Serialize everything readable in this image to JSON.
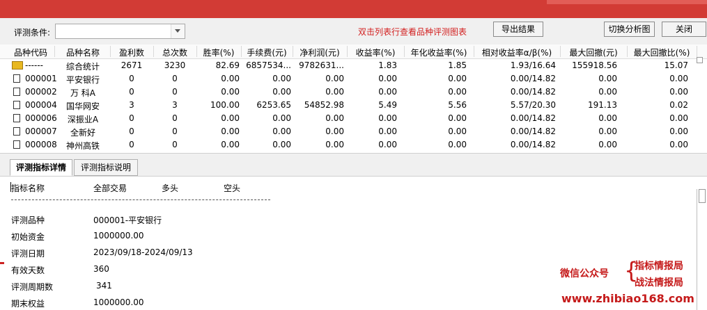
{
  "toolbar": {
    "condition_label": "评测条件:",
    "condition_value": "",
    "hint": "双击列表行查看品种评测图表",
    "export_label": "导出结果",
    "switch_label": "切换分析图",
    "close_label": "关闭"
  },
  "table": {
    "columns": [
      "品种代码",
      "品种名称",
      "盈利数",
      "总次数",
      "胜率(%)",
      "手续费(元)",
      "净利润(元)",
      "收益率(%)",
      "年化收益率(%)",
      "相对收益率α/β(%)",
      "最大回撤(元)",
      "最大回撤比(%)"
    ],
    "rows": [
      {
        "icon": "folder",
        "code": "------",
        "name": "综合统计",
        "win": "2671",
        "total": "3230",
        "rate": "82.69",
        "fee": "6857534...",
        "profit": "9782631...",
        "ret": "1.83",
        "annual": "1.85",
        "rel": "1.93/16.64",
        "dd": "155918.56",
        "ddr": "15.07"
      },
      {
        "icon": "doc",
        "code": "000001",
        "name": "平安银行",
        "win": "0",
        "total": "0",
        "rate": "0.00",
        "fee": "0.00",
        "profit": "0.00",
        "ret": "0.00",
        "annual": "0.00",
        "rel": "0.00/14.82",
        "dd": "0.00",
        "ddr": "0.00"
      },
      {
        "icon": "doc",
        "code": "000002",
        "name": "万 科A",
        "win": "0",
        "total": "0",
        "rate": "0.00",
        "fee": "0.00",
        "profit": "0.00",
        "ret": "0.00",
        "annual": "0.00",
        "rel": "0.00/14.82",
        "dd": "0.00",
        "ddr": "0.00"
      },
      {
        "icon": "doc",
        "code": "000004",
        "name": "国华网安",
        "win": "3",
        "total": "3",
        "rate": "100.00",
        "fee": "6253.65",
        "profit": "54852.98",
        "ret": "5.49",
        "annual": "5.56",
        "rel": "5.57/20.30",
        "dd": "191.13",
        "ddr": "0.02"
      },
      {
        "icon": "doc",
        "code": "000006",
        "name": "深振业A",
        "win": "0",
        "total": "0",
        "rate": "0.00",
        "fee": "0.00",
        "profit": "0.00",
        "ret": "0.00",
        "annual": "0.00",
        "rel": "0.00/14.82",
        "dd": "0.00",
        "ddr": "0.00"
      },
      {
        "icon": "doc",
        "code": "000007",
        "name": "全新好",
        "win": "0",
        "total": "0",
        "rate": "0.00",
        "fee": "0.00",
        "profit": "0.00",
        "ret": "0.00",
        "annual": "0.00",
        "rel": "0.00/14.82",
        "dd": "0.00",
        "ddr": "0.00"
      },
      {
        "icon": "doc",
        "code": "000008",
        "name": "神州高铁",
        "win": "0",
        "total": "0",
        "rate": "0.00",
        "fee": "0.00",
        "profit": "0.00",
        "ret": "0.00",
        "annual": "0.00",
        "rel": "0.00/14.82",
        "dd": "0.00",
        "ddr": "0.00"
      }
    ]
  },
  "tabs": {
    "details": "评测指标详情",
    "explain": "评测指标说明"
  },
  "detail": {
    "headers": [
      "指标名称",
      "全部交易",
      "多头",
      "空头"
    ],
    "items": [
      {
        "label": "评测品种",
        "value": "000001-平安银行"
      },
      {
        "label": "初始资金",
        "value": "1000000.00"
      },
      {
        "label": "评测日期",
        "value": "2023/09/18-2024/09/13"
      },
      {
        "label": "有效天数",
        "value": "360"
      },
      {
        "label": "评测周期数",
        "value": "341"
      },
      {
        "label": "期末权益",
        "value": "1000000.00"
      }
    ]
  },
  "watermark": {
    "wechat": "微信公众号",
    "brace": "{",
    "line1": "指标情报局",
    "line2": "战法情报局",
    "url": "www.zhibiao168.com"
  },
  "colors": {
    "titlebar": "#d23b35",
    "hint": "#d21f1f",
    "watermark": "#c51a1a"
  }
}
